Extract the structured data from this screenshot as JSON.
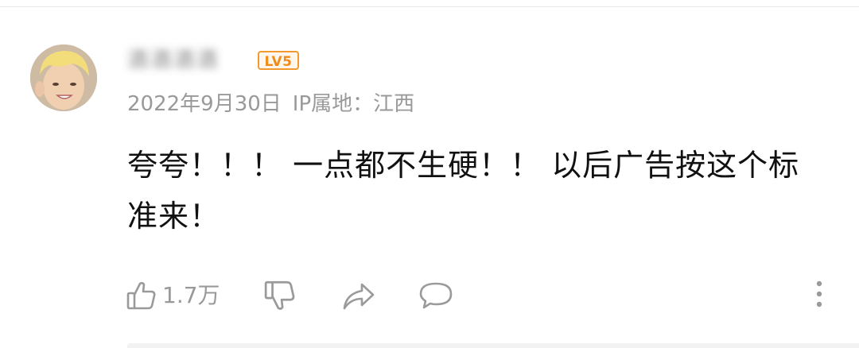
{
  "comment": {
    "username": "酒酒酒酒",
    "level_badge": "LV5",
    "date": "2022年9月30日",
    "ip_location": "IP属地：江西",
    "text": "夸夸！！！ 一点都不生硬！！ 以后广告按这个标准来！"
  },
  "actions": {
    "like_count": "1.7万",
    "icons": [
      "thumbs-up-icon",
      "thumbs-down-icon",
      "share-icon",
      "reply-icon",
      "more-icon"
    ]
  },
  "colors": {
    "meta_text": "#999999",
    "comment_text": "#111111",
    "badge_orange": "#f08c1a"
  }
}
